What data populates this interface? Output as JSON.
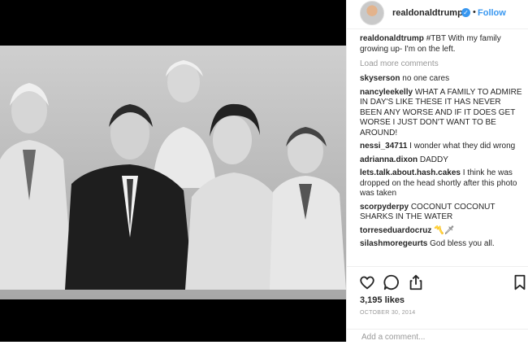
{
  "post": {
    "username": "realdonaldtrump",
    "follow_label": "Follow",
    "dot": "•",
    "verified_glyph": "✓",
    "caption_text": "#TBT With my family growing up- I'm on the left.",
    "load_more": "Load more comments",
    "comments": [
      {
        "user": "skyserson",
        "text": "no one cares"
      },
      {
        "user": "nancyleekelly",
        "text": "WHAT A FAMILY TO ADMIRE IN DAY'S LIKE THESE IT HAS NEVER BEEN ANY WORSE AND IF IT DOES GET WORSE I JUST DON'T WANT TO BE AROUND!"
      },
      {
        "user": "nessi_34711",
        "text": "I wonder what they did wrong"
      },
      {
        "user": "adrianna.dixon",
        "text": "DADDY"
      },
      {
        "user": "lets.talk.about.hash.cakes",
        "text": "I think he was dropped on the head shortly after this photo was taken"
      },
      {
        "user": "scorpyderpy",
        "text": "COCONUT COCONUT SHARKS IN THE WATER"
      },
      {
        "user": "torreseduardocruz",
        "text": "〽️🗡"
      },
      {
        "user": "silashmoregeurts",
        "text": "God bless you all."
      }
    ],
    "likes": "3,195 likes",
    "date": "OCTOBER 30, 2014",
    "add_comment_placeholder": "Add a comment..."
  },
  "icons": [
    "heart-icon",
    "comment-icon",
    "share-icon",
    "bookmark-icon"
  ],
  "colors": {
    "link_blue": "#3897f0",
    "muted": "#999999",
    "text": "#262626",
    "border": "#efefef"
  }
}
